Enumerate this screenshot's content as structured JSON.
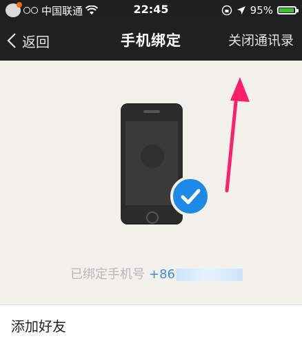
{
  "status_bar": {
    "carrier": "中国联通",
    "time": "22:45",
    "battery_percent": "95%",
    "battery_level": 0.95
  },
  "nav": {
    "back_label": "返回",
    "title": "手机绑定",
    "right_action": "关闭通讯录"
  },
  "content": {
    "bound_label": "已绑定手机号",
    "bound_number_visible": "+86"
  },
  "list": {
    "add_friends": "添加好友"
  },
  "colors": {
    "accent_blue": "#1c8ae6",
    "annotation_arrow": "#ff1f6b",
    "navbar_bg": "#202020"
  }
}
